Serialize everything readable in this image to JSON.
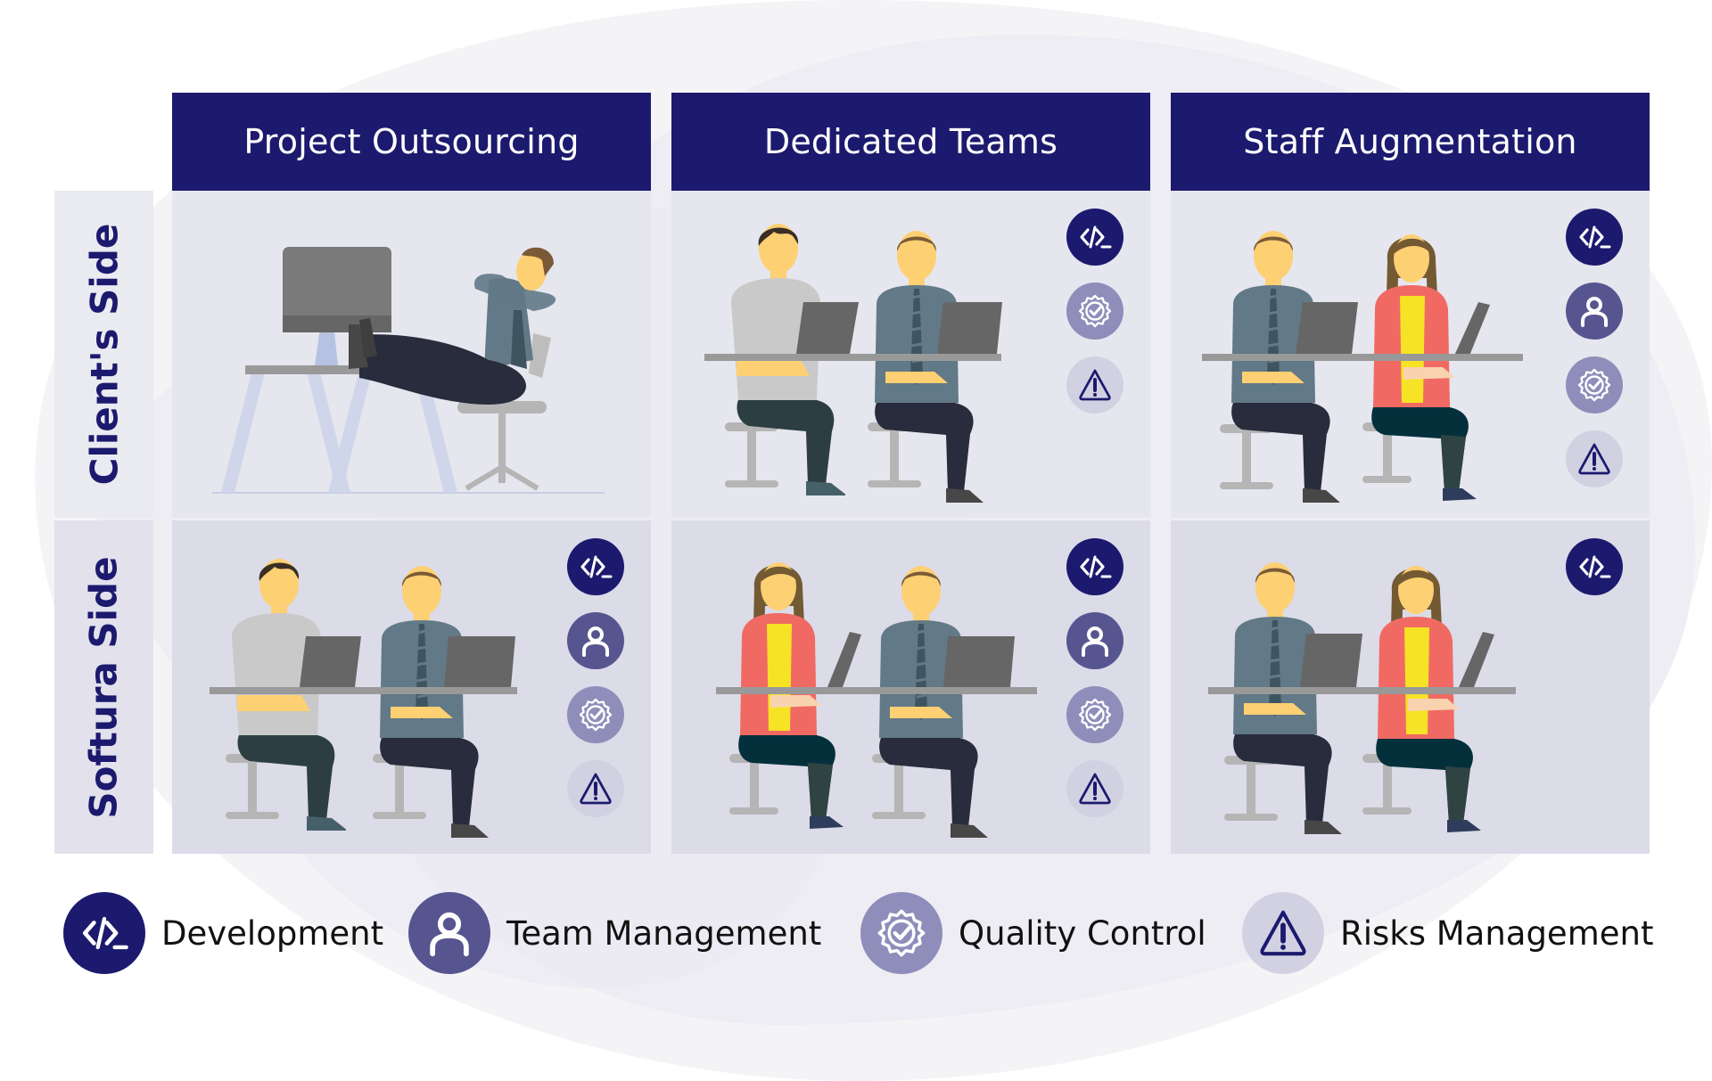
{
  "columns": [
    {
      "title": "Project Outsourcing"
    },
    {
      "title": "Dedicated Teams"
    },
    {
      "title": "Staff Augmentation"
    }
  ],
  "rows": [
    {
      "label": "Client's Side"
    },
    {
      "label": "Softura Side"
    }
  ],
  "cells": {
    "project_outsourcing_client": {
      "scene": "relaxing-man-feet-on-desk",
      "icons": []
    },
    "dedicated_teams_client": {
      "scene": "two-men-at-laptops",
      "icons": [
        "development",
        "quality-control",
        "risks-management"
      ]
    },
    "staff_augmentation_client": {
      "scene": "man-and-woman-at-laptops",
      "icons": [
        "development",
        "team-management",
        "quality-control",
        "risks-management"
      ]
    },
    "project_outsourcing_softura": {
      "scene": "two-men-at-laptops",
      "icons": [
        "development",
        "team-management",
        "quality-control",
        "risks-management"
      ]
    },
    "dedicated_teams_softura": {
      "scene": "woman-and-man-at-laptops",
      "icons": [
        "development",
        "team-management",
        "quality-control",
        "risks-management"
      ]
    },
    "staff_augmentation_softura": {
      "scene": "man-and-woman-at-laptops",
      "icons": [
        "development"
      ]
    }
  },
  "legend": [
    {
      "key": "development",
      "label": "Development",
      "icon": "code-terminal-icon",
      "color": "#1c1a6e"
    },
    {
      "key": "team-management",
      "label": "Team Management",
      "icon": "user-icon",
      "color": "#56558f"
    },
    {
      "key": "quality-control",
      "label": "Quality Control",
      "icon": "badge-check-icon",
      "color": "#8f8dba"
    },
    {
      "key": "risks-management",
      "label": "Risks Management",
      "icon": "warning-triangle-icon",
      "color": "#d2d1e2"
    }
  ],
  "colors": {
    "header_bg": "#1c1a6e",
    "header_text": "#ffffff",
    "row_label_text": "#1c1a6e",
    "client_row_bg": "#e6e6ef",
    "softura_row_bg": "#dcdbe8"
  }
}
